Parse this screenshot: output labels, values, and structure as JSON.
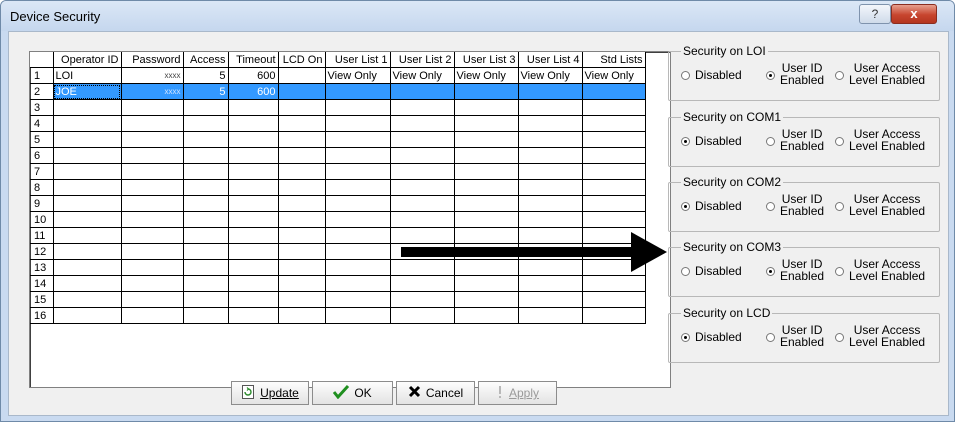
{
  "window": {
    "title": "Device Security",
    "help": "?",
    "close": "x"
  },
  "grid": {
    "headers": [
      "",
      "Operator ID",
      "Password",
      "Access",
      "Timeout",
      "LCD On",
      "User List 1",
      "User List 2",
      "User List 3",
      "User List 4",
      "Std Lists"
    ],
    "rows": [
      [
        "1",
        "LOI",
        "xxxx",
        "5",
        "600",
        "",
        "View Only",
        "View Only",
        "View Only",
        "View Only",
        "View Only"
      ],
      [
        "2",
        "JOE",
        "xxxx",
        "5",
        "600",
        "",
        "",
        "",
        "",
        "",
        ""
      ],
      [
        "3",
        "",
        "",
        "",
        "",
        "",
        "",
        "",
        "",
        "",
        ""
      ],
      [
        "4",
        "",
        "",
        "",
        "",
        "",
        "",
        "",
        "",
        "",
        ""
      ],
      [
        "5",
        "",
        "",
        "",
        "",
        "",
        "",
        "",
        "",
        "",
        ""
      ],
      [
        "6",
        "",
        "",
        "",
        "",
        "",
        "",
        "",
        "",
        "",
        ""
      ],
      [
        "7",
        "",
        "",
        "",
        "",
        "",
        "",
        "",
        "",
        "",
        ""
      ],
      [
        "8",
        "",
        "",
        "",
        "",
        "",
        "",
        "",
        "",
        "",
        ""
      ],
      [
        "9",
        "",
        "",
        "",
        "",
        "",
        "",
        "",
        "",
        "",
        ""
      ],
      [
        "10",
        "",
        "",
        "",
        "",
        "",
        "",
        "",
        "",
        "",
        ""
      ],
      [
        "11",
        "",
        "",
        "",
        "",
        "",
        "",
        "",
        "",
        "",
        ""
      ],
      [
        "12",
        "",
        "",
        "",
        "",
        "",
        "",
        "",
        "",
        "",
        ""
      ],
      [
        "13",
        "",
        "",
        "",
        "",
        "",
        "",
        "",
        "",
        "",
        ""
      ],
      [
        "14",
        "",
        "",
        "",
        "",
        "",
        "",
        "",
        "",
        "",
        ""
      ],
      [
        "15",
        "",
        "",
        "",
        "",
        "",
        "",
        "",
        "",
        "",
        ""
      ],
      [
        "16",
        "",
        "",
        "",
        "",
        "",
        "",
        "",
        "",
        "",
        ""
      ]
    ],
    "selected_row": "2"
  },
  "buttons": {
    "update": {
      "label": "Update",
      "icon": "update-icon"
    },
    "ok": {
      "label": "OK",
      "icon": "checkmark-icon"
    },
    "cancel": {
      "label": "Cancel",
      "icon": "x-icon"
    },
    "apply": {
      "label": "Apply",
      "icon": "exclamation-icon"
    }
  },
  "security_groups": [
    {
      "title": "Security on LOI",
      "selected": "user_id"
    },
    {
      "title": "Security on COM1",
      "selected": "disabled"
    },
    {
      "title": "Security on COM2",
      "selected": "disabled"
    },
    {
      "title": "Security on COM3",
      "selected": "user_id"
    },
    {
      "title": "Security on LCD",
      "selected": "disabled"
    }
  ],
  "options": {
    "disabled": "Disabled",
    "user_id_1": "User ID",
    "user_id_2": "Enabled",
    "user_access_1": "User Access",
    "user_access_2": "Level Enabled"
  },
  "colors": {
    "selection": "#3399ff",
    "title_bar": "#c9daf0",
    "close_button": "#c7452e"
  }
}
